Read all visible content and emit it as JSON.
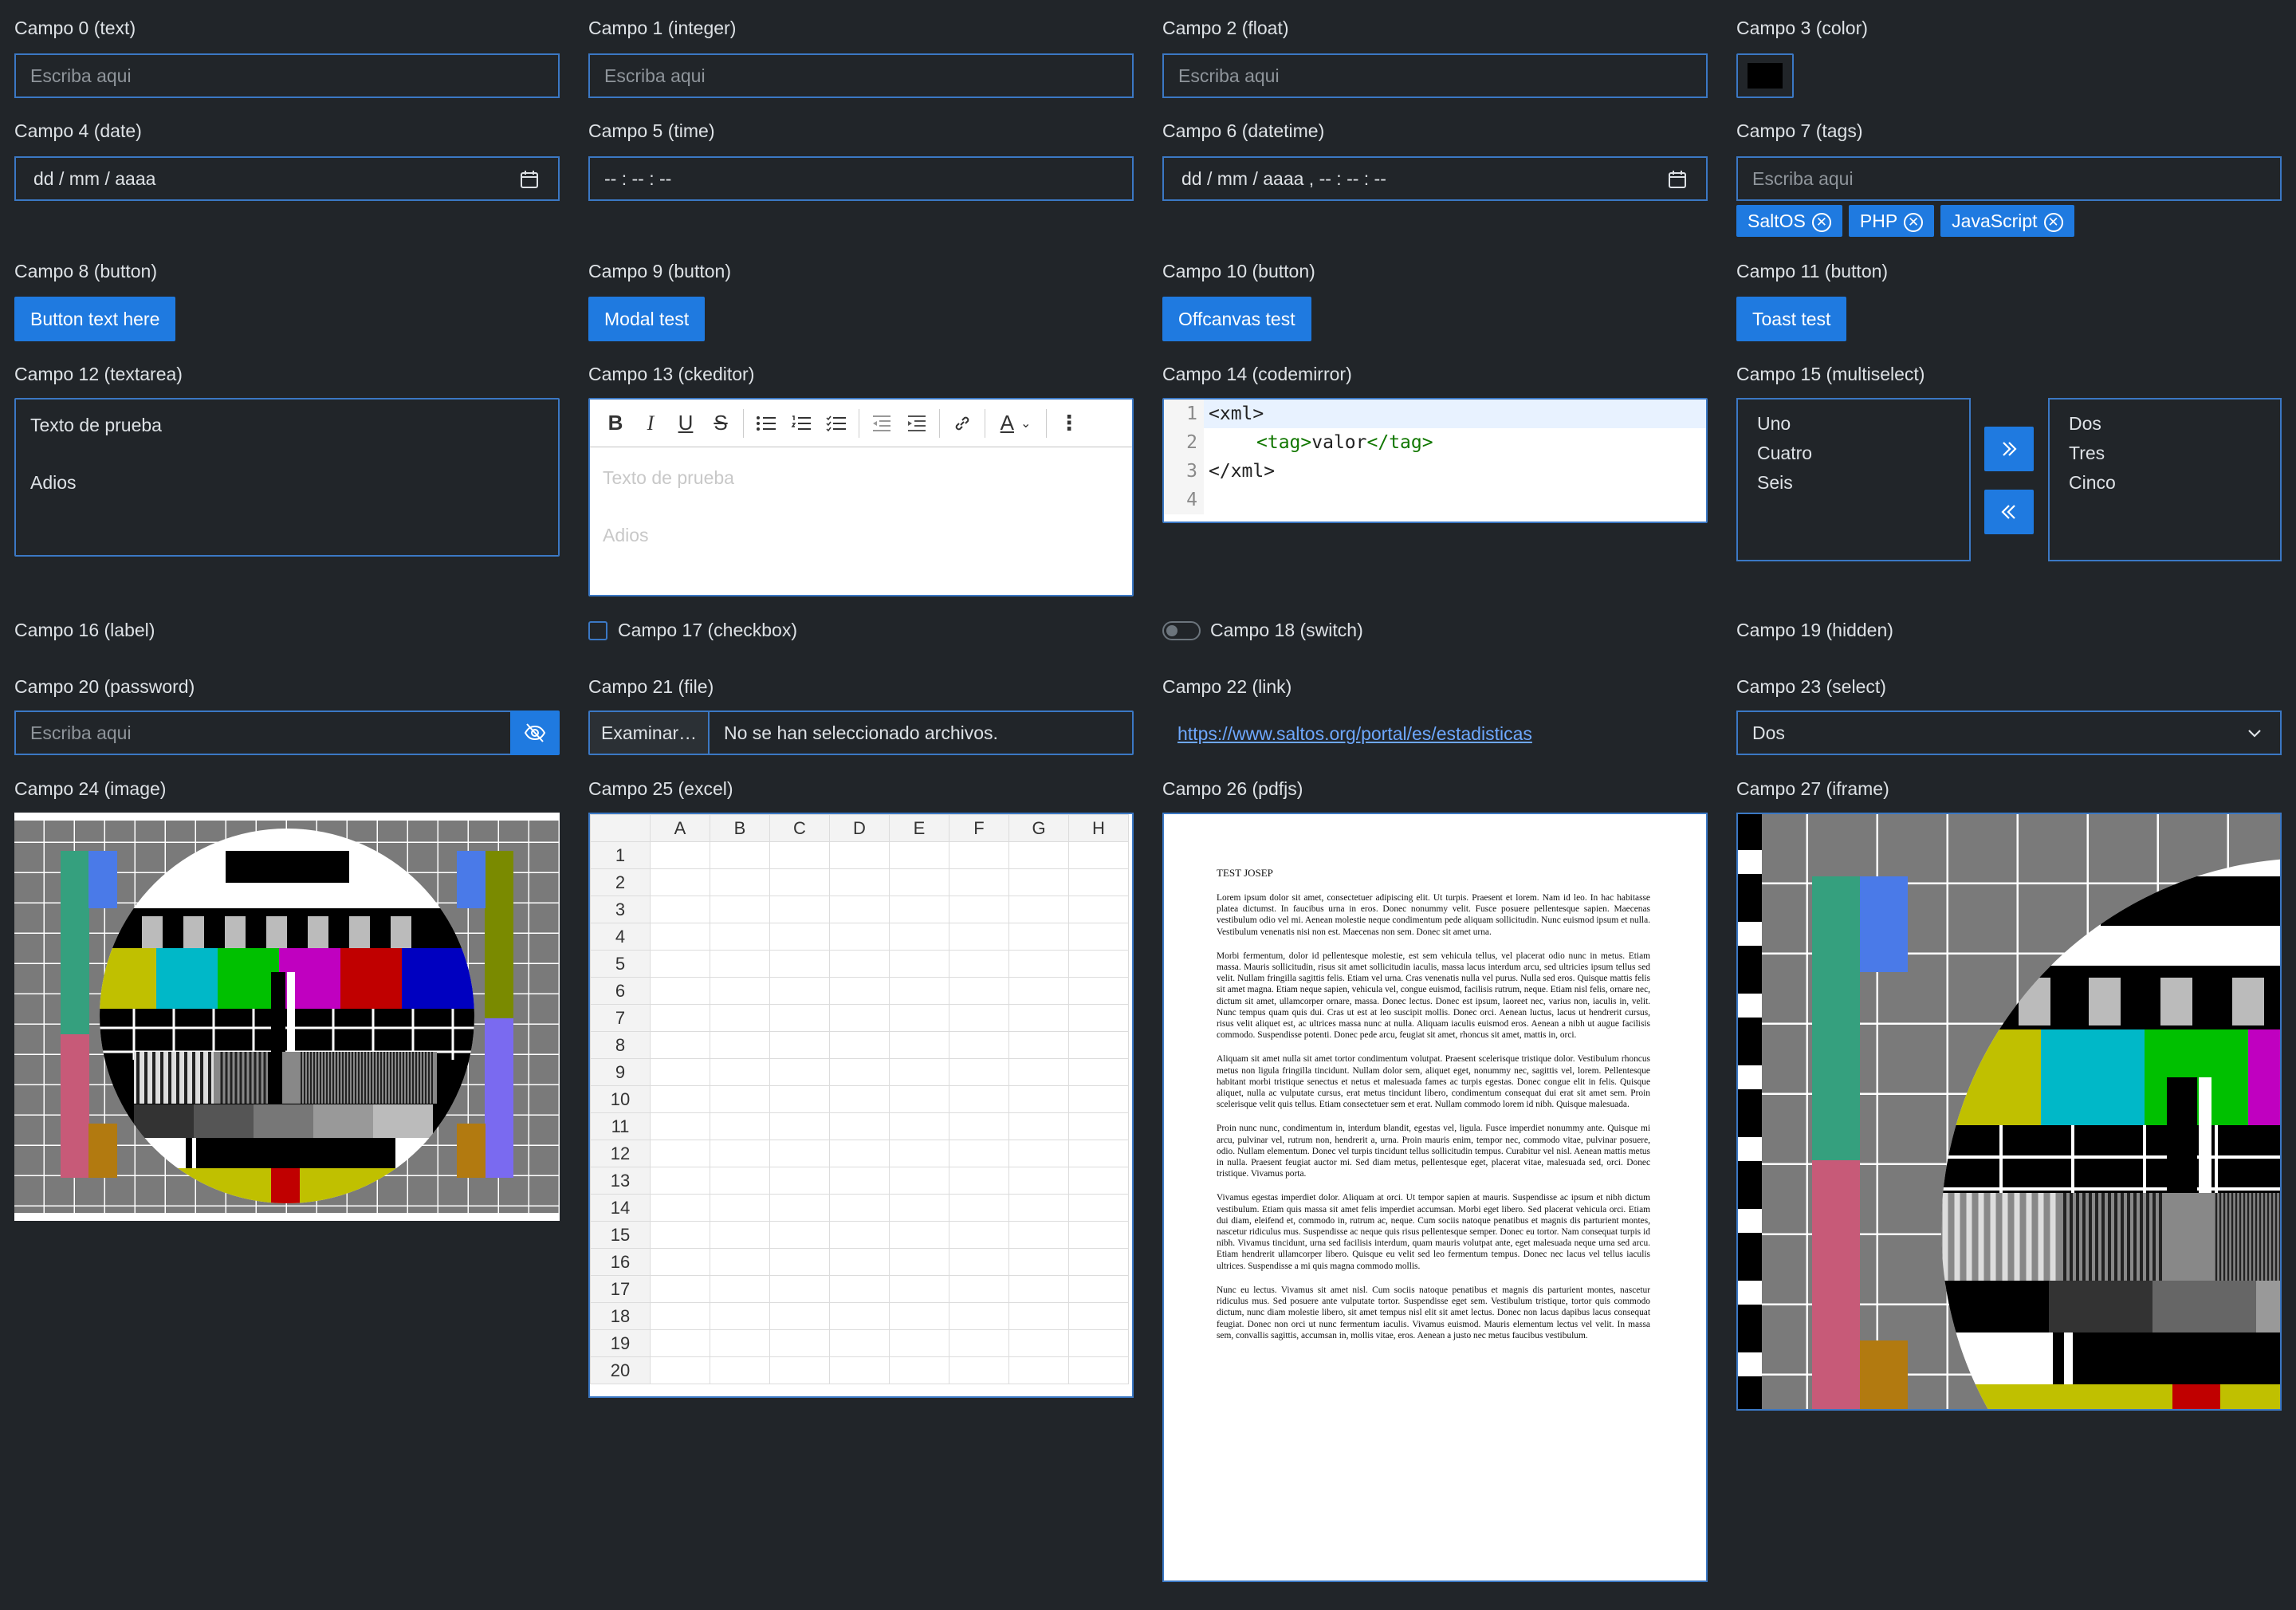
{
  "f0": {
    "label": "Campo 0 (text)",
    "placeholder": "Escriba aqui"
  },
  "f1": {
    "label": "Campo 1 (integer)",
    "placeholder": "Escriba aqui"
  },
  "f2": {
    "label": "Campo 2 (float)",
    "placeholder": "Escriba aqui"
  },
  "f3": {
    "label": "Campo 3 (color)",
    "value": "#000000"
  },
  "f4": {
    "label": "Campo 4 (date)",
    "placeholder": "dd / mm / aaaa"
  },
  "f5": {
    "label": "Campo 5 (time)",
    "placeholder": "-- : -- : --"
  },
  "f6": {
    "label": "Campo 6 (datetime)",
    "placeholder": "dd / mm / aaaa ,  -- : -- : --"
  },
  "f7": {
    "label": "Campo 7 (tags)",
    "placeholder": "Escriba aqui",
    "tags": [
      "SaltOS",
      "PHP",
      "JavaScript"
    ]
  },
  "f8": {
    "label": "Campo 8 (button)",
    "button": "Button text here"
  },
  "f9": {
    "label": "Campo 9 (button)",
    "button": "Modal test"
  },
  "f10": {
    "label": "Campo 10 (button)",
    "button": "Offcanvas test"
  },
  "f11": {
    "label": "Campo 11 (button)",
    "button": "Toast test"
  },
  "f12": {
    "label": "Campo 12 (textarea)",
    "line1": "Texto de prueba",
    "line2": "Adios"
  },
  "f13": {
    "label": "Campo 13 (ckeditor)",
    "line1": "Texto de prueba",
    "line2": "Adios"
  },
  "f14": {
    "label": "Campo 14 (codemirror)",
    "lines": [
      "1",
      "2",
      "3",
      "4"
    ],
    "code": {
      "open": "<xml>",
      "tag_open": "<tag>",
      "value": "valor",
      "tag_close": "</tag>",
      "close": "</xml>"
    }
  },
  "f15": {
    "label": "Campo 15 (multiselect)",
    "left": [
      "Uno",
      "Cuatro",
      "Seis"
    ],
    "right": [
      "Dos",
      "Tres",
      "Cinco"
    ]
  },
  "f16": {
    "label": "Campo 16 (label)"
  },
  "f17": {
    "label": "Campo 17 (checkbox)"
  },
  "f18": {
    "label": "Campo 18 (switch)"
  },
  "f19": {
    "label": "Campo 19 (hidden)"
  },
  "f20": {
    "label": "Campo 20 (password)",
    "placeholder": "Escriba aqui"
  },
  "f21": {
    "label": "Campo 21 (file)",
    "button": "Examinar…",
    "status": "No se han seleccionado archivos."
  },
  "f22": {
    "label": "Campo 22 (link)",
    "url": "https://www.saltos.org/portal/es/estadisticas"
  },
  "f23": {
    "label": "Campo 23 (select)",
    "value": "Dos"
  },
  "f24": {
    "label": "Campo 24 (image)"
  },
  "f25": {
    "label": "Campo 25 (excel)",
    "columns": [
      "A",
      "B",
      "C",
      "D",
      "E",
      "F",
      "G",
      "H"
    ],
    "rows": [
      "1",
      "2",
      "3",
      "4",
      "5",
      "6",
      "7",
      "8",
      "9",
      "10",
      "11",
      "12",
      "13",
      "14",
      "15",
      "16",
      "17",
      "18",
      "19",
      "20"
    ]
  },
  "f26": {
    "label": "Campo 26 (pdfjs)",
    "title": "TEST JOSEP",
    "paragraphs": [
      "Lorem ipsum dolor sit amet, consectetuer adipiscing elit. Ut turpis. Praesent et lorem. Nam id leo. In hac habitasse platea dictumst. In faucibus urna in eros. Donec nonummy velit. Fusce posuere pellentesque sapien. Maecenas vestibulum odio vel mi. Aenean molestie neque condimentum pede aliquam sollicitudin. Nunc euismod ipsum et nulla. Vestibulum venenatis nisi non est. Maecenas non sem. Donec sit amet urna.",
      "Morbi fermentum, dolor id pellentesque molestie, est sem vehicula tellus, vel placerat odio nunc in metus. Etiam massa. Mauris sollicitudin, risus sit amet sollicitudin iaculis, massa lacus interdum arcu, sed ultricies ipsum tellus sed velit. Nullam fringilla sagittis felis. Etiam vel urna. Cras venenatis nulla vel purus. Nulla sed eros. Quisque mattis felis sit amet magna. Etiam neque sapien, vehicula vel, congue euismod, facilisis rutrum, neque. Etiam nisl felis, ornare nec, dictum sit amet, ullamcorper ornare, massa. Donec lectus. Donec est ipsum, laoreet nec, varius non, iaculis in, velit. Nunc tempus quam quis dui. Cras ut est at leo suscipit mollis. Donec orci. Aenean luctus, lacus ut hendrerit cursus, risus velit aliquet est, ac ultrices massa nunc at nulla. Aliquam iaculis euismod eros. Aenean a nibh ut augue facilisis commodo. Suspendisse potenti. Donec pede arcu, feugiat sit amet, rhoncus sit amet, mattis in, orci.",
      "Aliquam sit amet nulla sit amet tortor condimentum volutpat. Praesent scelerisque tristique dolor. Vestibulum rhoncus metus non ligula fringilla tincidunt. Nullam dolor sem, aliquet eget, nonummy nec, sagittis vel, lorem. Pellentesque habitant morbi tristique senectus et netus et malesuada fames ac turpis egestas. Donec congue elit in felis. Quisque aliquet, nulla ac vulputate cursus, erat metus tincidunt libero, condimentum consequat dui erat sit amet sem. Proin scelerisque velit quis tellus. Etiam consectetuer sem et erat. Nullam commodo lorem id nibh. Quisque malesuada.",
      "Proin nunc nunc, condimentum in, interdum blandit, egestas vel, ligula. Fusce imperdiet nonummy ante. Quisque mi arcu, pulvinar vel, rutrum non, hendrerit a, urna. Proin mauris enim, tempor nec, commodo vitae, pulvinar posuere, odio. Nullam elementum. Donec vel turpis tincidunt tellus sollicitudin tempus. Curabitur vel nisl. Aenean mattis metus in nulla. Praesent feugiat auctor mi. Sed diam metus, pellentesque eget, placerat vitae, malesuada sed, orci. Donec tristique. Vivamus porta.",
      "Vivamus egestas imperdiet dolor. Aliquam at orci. Ut tempor sapien at mauris. Suspendisse ac ipsum et nibh dictum vestibulum. Etiam quis massa sit amet felis imperdiet accumsan. Morbi eget libero. Sed placerat vehicula orci. Etiam dui diam, eleifend et, commodo in, rutrum ac, neque. Cum sociis natoque penatibus et magnis dis parturient montes, nascetur ridiculus mus. Suspendisse ac neque quis risus pellentesque semper. Donec eu tortor. Nam consequat turpis id nibh. Vivamus tincidunt, urna sed facilisis interdum, quam mauris volutpat ante, eget malesuada neque urna sed arcu. Etiam hendrerit ullamcorper libero. Quisque eu velit sed leo fermentum tempus. Donec nec lacus vel tellus iaculis ultrices. Suspendisse a mi quis magna commodo mollis.",
      "Nunc eu lectus. Vivamus sit amet nisl. Cum sociis natoque penatibus et magnis dis parturient montes, nascetur ridiculus mus. Sed posuere ante vulputate tortor. Suspendisse eget sem. Vestibulum tristique, tortor quis commodo dictum, nunc diam molestie libero, sit amet tempus nisl elit sit amet lectus. Donec non lacus dapibus lacus consequat feugiat. Donec non orci ut nunc fermentum iaculis. Vivamus euismod. Mauris elementum lectus vel velit. In massa sem, convallis sagittis, accumsan in, mollis vitae, eros. Aenean a justo nec metus faucibus vestibulum."
    ]
  },
  "f27": {
    "label": "Campo 27 (iframe)"
  },
  "testcard_colors": [
    "#c0c000",
    "#00b8c8",
    "#00c000",
    "#c000c0",
    "#c00000",
    "#0000c0"
  ]
}
